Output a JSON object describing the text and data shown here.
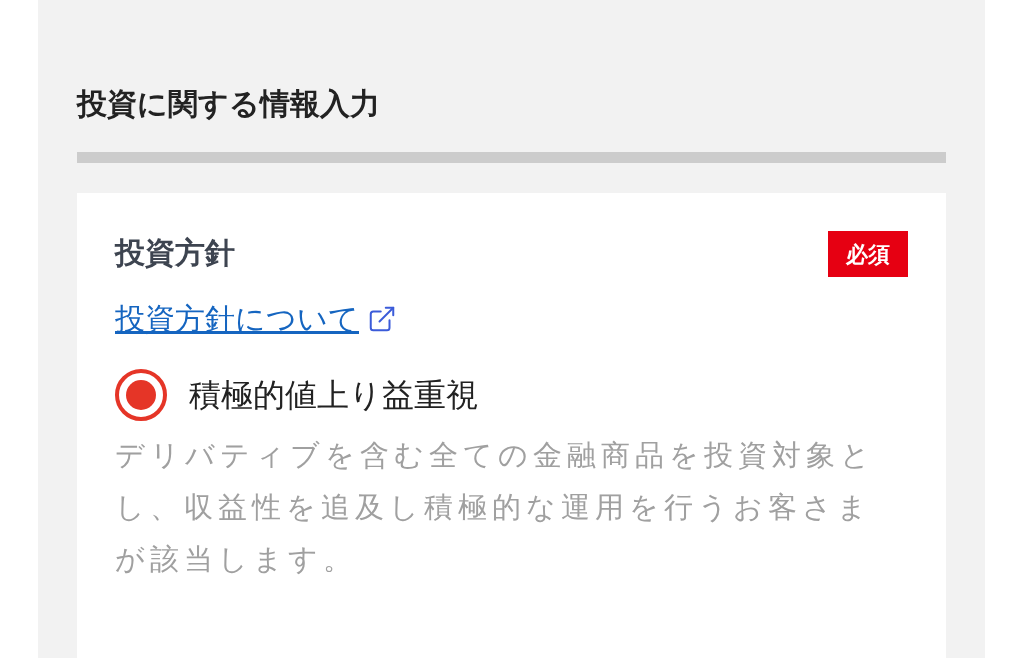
{
  "section_title": "投資に関する情報入力",
  "field": {
    "label": "投資方針",
    "required_badge": "必須",
    "link": "投資方針について",
    "options": [
      {
        "label": "積極的値上り益重視",
        "selected": true,
        "description": "デリバティブを含む全ての金融商品を投資対象とし、収益性を追及し積極的な運用を行うお客さまが該当します。"
      }
    ]
  }
}
